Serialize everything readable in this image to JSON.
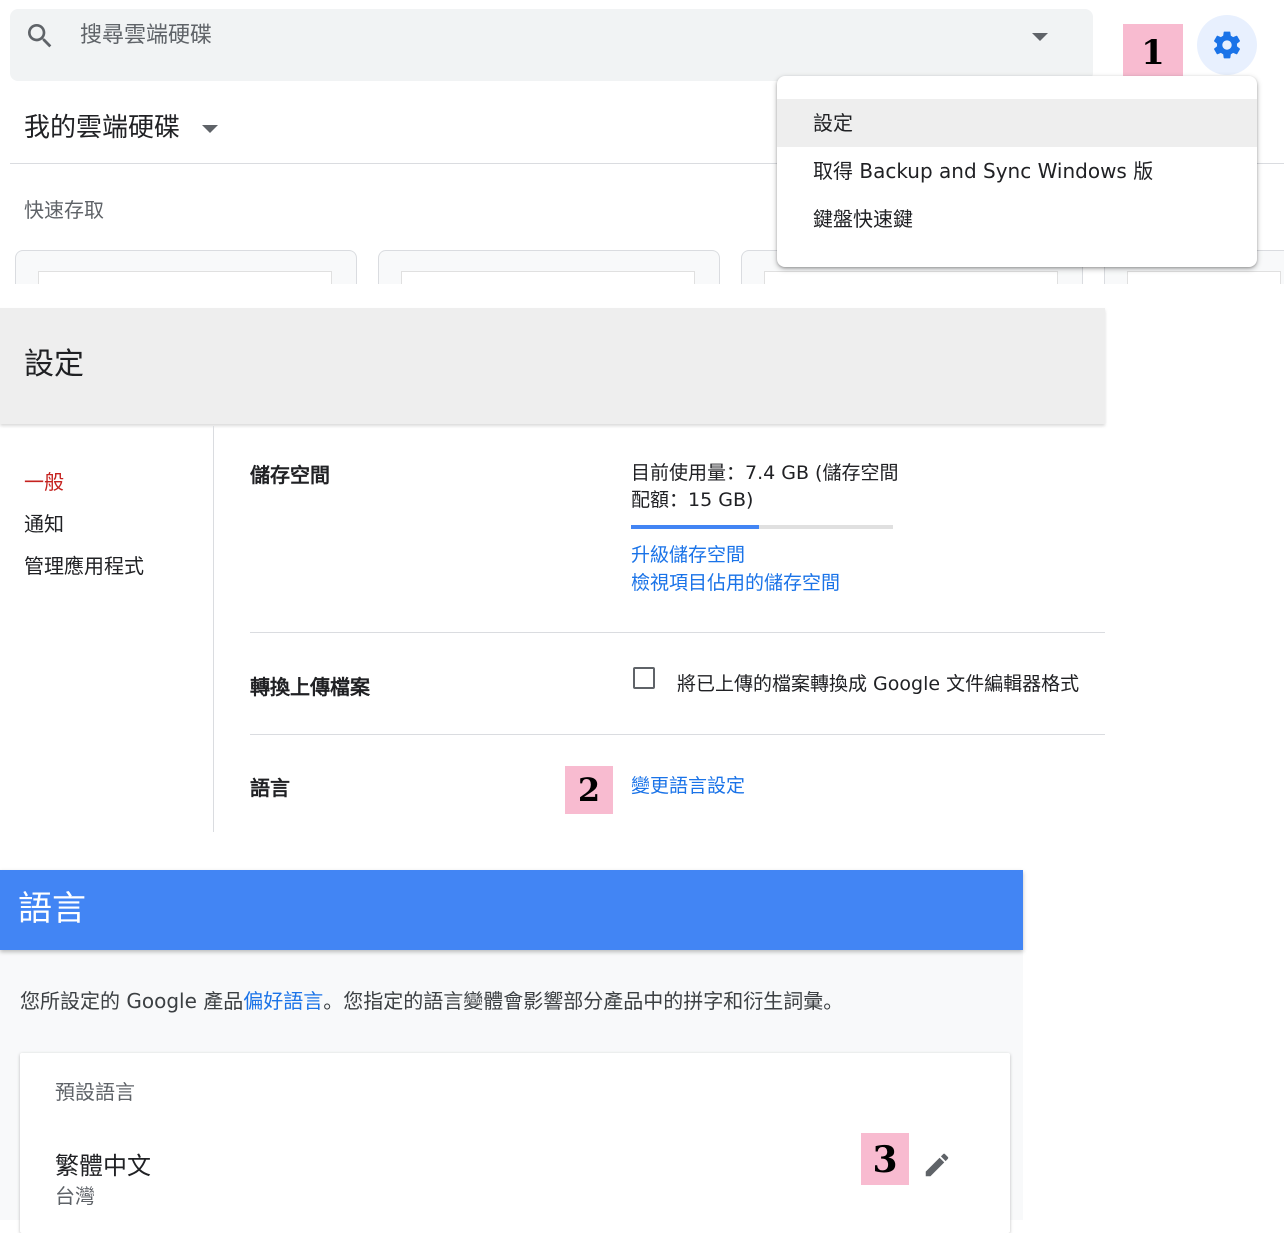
{
  "drive": {
    "search_placeholder": "搜尋雲端硬碟",
    "title": "我的雲端硬碟",
    "quick_access": "快速存取",
    "menu": {
      "settings": "設定",
      "backup": "取得 Backup and Sync Windows 版",
      "shortcuts": "鍵盤快速鍵"
    }
  },
  "badges": {
    "one": "1",
    "two": "2",
    "three": "3"
  },
  "settings": {
    "title": "設定",
    "nav": {
      "general": "一般",
      "notifications": "通知",
      "manage_apps": "管理應用程式"
    },
    "storage": {
      "label": "儲存空間",
      "usage": "目前使用量：7.4 GB (儲存空間配額：15 GB)",
      "used_fraction": 0.49,
      "upgrade": "升級儲存空間",
      "view": "檢視項目佔用的儲存空間"
    },
    "convert": {
      "label": "轉換上傳檔案",
      "option": "將已上傳的檔案轉換成 Google 文件編輯器格式",
      "checked": false
    },
    "language": {
      "label": "語言",
      "change": "變更語言設定"
    }
  },
  "language_page": {
    "title": "語言",
    "desc_prefix": "您所設定的 Google 產品",
    "desc_link": "偏好語言",
    "desc_suffix": "。您指定的語言變體會影響部分產品中的拼字和衍生詞彙。",
    "default_label": "預設語言",
    "language": "繁體中文",
    "region": "台灣"
  },
  "colors": {
    "accent": "#4285f4",
    "link": "#1a73e8",
    "active_nav": "#c5221f",
    "badge": "#f8bbd0"
  }
}
